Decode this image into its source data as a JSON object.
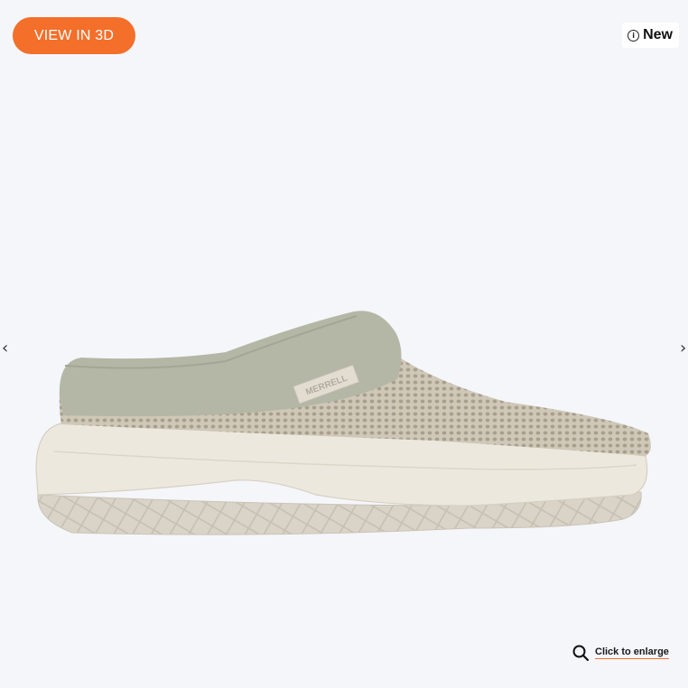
{
  "view3d_label": "VIEW IN 3D",
  "badge": {
    "icon": "info-icon",
    "label": "New"
  },
  "nav": {
    "prev_icon": "chevron-left-icon",
    "next_icon": "chevron-right-icon",
    "prev_glyph": "‹",
    "next_glyph": "›"
  },
  "product_image": {
    "logo_text": "MERRELL",
    "colors": {
      "upper": "#cbc3b3",
      "collar": "#b5b7a6",
      "sole": "#ece8de",
      "outsole": "#d8d3c6"
    }
  },
  "enlarge": {
    "icon": "search-icon",
    "label": "Click to enlarge"
  },
  "colors": {
    "accent": "#f36f2a",
    "background": "#f5f6fa"
  }
}
